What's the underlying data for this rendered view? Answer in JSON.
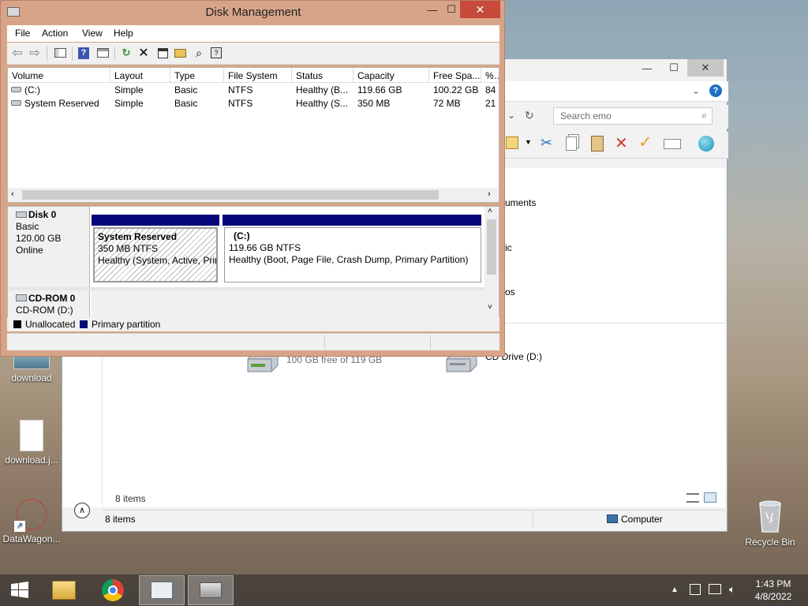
{
  "desktop": {
    "icons": [
      {
        "label": "download"
      },
      {
        "label": "download.j..."
      },
      {
        "label": "DataWagon..."
      },
      {
        "label": "Recycle Bin"
      }
    ]
  },
  "explorer": {
    "search_placeholder": "Search emo",
    "nav_items": [
      "uments",
      "ic",
      "os"
    ],
    "drive_c_free": "100 GB free of 119 GB",
    "drive_c_free_fraction": 0.16,
    "drive_d_label": "CD Drive (D:)",
    "items_count_content": "8 items",
    "status_items": "8 items",
    "status_location": "Computer"
  },
  "disk_management": {
    "title": "Disk Management",
    "menu": [
      "File",
      "Action",
      "View",
      "Help"
    ],
    "toolbar_icons": [
      "back-arrow-icon",
      "forward-arrow-icon",
      "console-tree-icon",
      "help-icon",
      "properties-pane-icon",
      "refresh-icon",
      "delete-icon",
      "properties-icon",
      "open-folder-icon",
      "find-icon",
      "help-topics-icon"
    ],
    "columns": [
      "Volume",
      "Layout",
      "Type",
      "File System",
      "Status",
      "Capacity",
      "Free Spa...",
      "% F"
    ],
    "volumes": [
      {
        "volume": "(C:)",
        "layout": "Simple",
        "type": "Basic",
        "fs": "NTFS",
        "status": "Healthy (B...",
        "capacity": "119.66 GB",
        "free": "100.22 GB",
        "pct": "84"
      },
      {
        "volume": "System Reserved",
        "layout": "Simple",
        "type": "Basic",
        "fs": "NTFS",
        "status": "Healthy (S...",
        "capacity": "350 MB",
        "free": "72 MB",
        "pct": "21"
      }
    ],
    "disks": [
      {
        "name": "Disk 0",
        "kind": "Basic",
        "size": "120.00 GB",
        "state": "Online",
        "partitions": [
          {
            "name": "System Reserved",
            "size_fs": "350 MB NTFS",
            "status": "Healthy (System, Active, Prir"
          },
          {
            "name": "(C:)",
            "size_fs": "119.66 GB NTFS",
            "status": "Healthy (Boot, Page File, Crash Dump, Primary Partition)"
          }
        ]
      },
      {
        "name": "CD-ROM 0",
        "kind": "CD-ROM (D:)"
      }
    ],
    "legend": [
      {
        "label": "Unallocated",
        "color": "#000000"
      },
      {
        "label": "Primary partition",
        "color": "#06067a"
      }
    ]
  },
  "taskbar": {
    "apps": [
      "file-explorer",
      "chrome",
      "performance-monitor",
      "disk-management"
    ],
    "clock_time": "1:43 PM",
    "clock_date": "4/8/2022"
  }
}
